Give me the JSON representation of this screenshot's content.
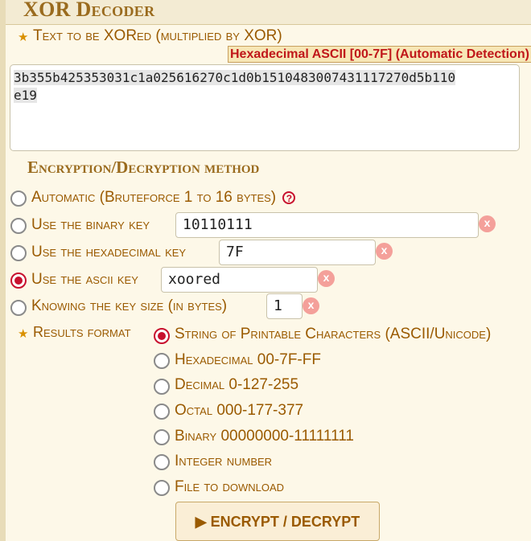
{
  "app": {
    "title": "XOR Decoder"
  },
  "input": {
    "label": "Text to be XORed (multiplied by XOR)",
    "detected_format": "Hexadecimal ASCII [00-7F] (Automatic Detection)",
    "value_line1": "3b355b425353031c1a025616270c1d0b151048300743111727​0d5b110",
    "value_line2": "e19"
  },
  "method": {
    "heading": "Encryption/Decryption method",
    "options": [
      {
        "label": "Automatic (Bruteforce 1 to 16 bytes)",
        "checked": false
      },
      {
        "label": "Use the binary key",
        "value": "10110111",
        "checked": false
      },
      {
        "label": "Use the hexadecimal key",
        "value": "7F",
        "checked": false
      },
      {
        "label": "Use the ascii key",
        "value": "xoored",
        "checked": true
      },
      {
        "label": "Knowing the key size (in bytes)",
        "value": "1",
        "checked": false
      }
    ],
    "help_glyph": "?",
    "clear_glyph": "x"
  },
  "results": {
    "label": "Results format",
    "options": [
      {
        "label": "String of Printable Characters (ASCII/Unicode)",
        "checked": true
      },
      {
        "label": "Hexadecimal 00-7F-FF",
        "checked": false
      },
      {
        "label": "Decimal 0-127-255",
        "checked": false
      },
      {
        "label": "Octal 000-177-377",
        "checked": false
      },
      {
        "label": "Binary 00000000-11111111",
        "checked": false
      },
      {
        "label": "Integer number",
        "checked": false
      },
      {
        "label": "File to download",
        "checked": false
      }
    ]
  },
  "submit": {
    "label": "▶ ENCRYPT / DECRYPT"
  },
  "icons": {
    "star": "★",
    "help": "question-circle",
    "clear": "clear-x"
  },
  "colors": {
    "accent": "#c8102e",
    "label": "#9a5a00",
    "title": "#9a6b1e"
  }
}
